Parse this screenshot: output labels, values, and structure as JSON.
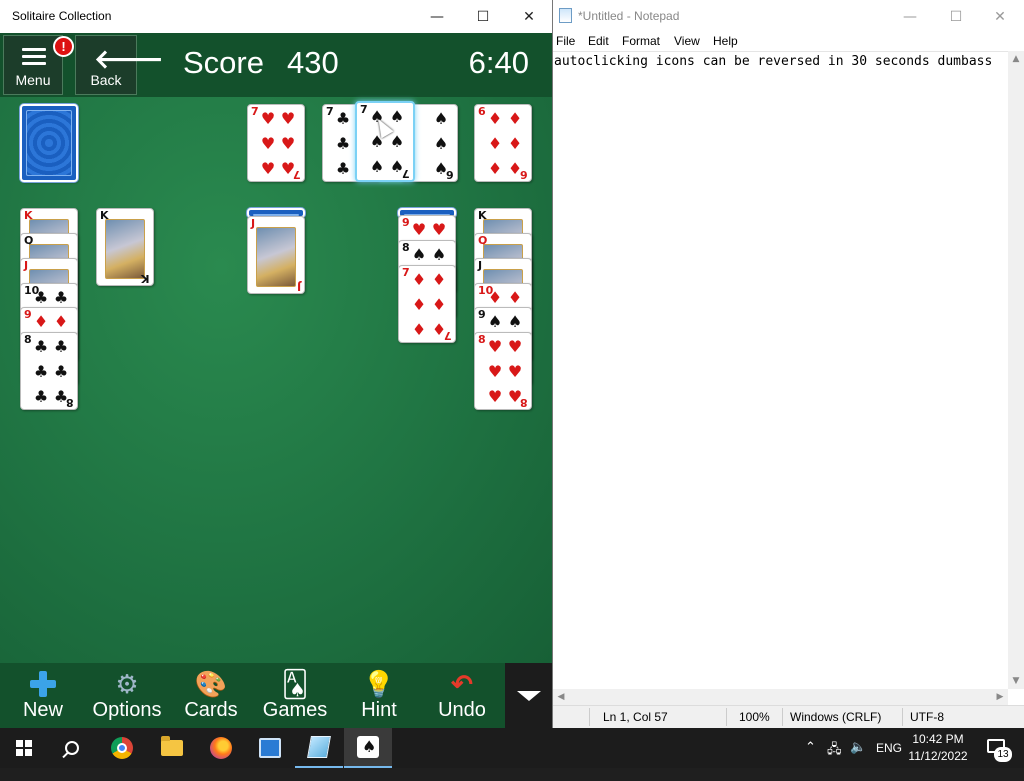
{
  "solitaire": {
    "title": "Solitaire Collection",
    "menu_label": "Menu",
    "alert_badge": "!",
    "back_label": "Back",
    "score_label": "Score",
    "score_value": "430",
    "timer": "6:40",
    "toolbar": {
      "new": "New",
      "options": "Options",
      "cards": "Cards",
      "games": "Games",
      "hint": "Hint",
      "undo": "Undo"
    },
    "cards": {
      "fd_7h": "7",
      "fd_7c": "7",
      "fd_7s": "7",
      "fd_6s": "6",
      "fd_6d": "6",
      "t1_K": "K",
      "t1_Q": "Q",
      "t1_J": "J",
      "t1_10": "10",
      "t1_9": "9",
      "t1_8": "8",
      "t2_K": "K",
      "t3_J": "J",
      "t4_9": "9",
      "t4_8": "8",
      "t4_7": "7",
      "t5_K": "K",
      "t5_Q": "Q",
      "t5_J": "J",
      "t5_10": "10",
      "t5_9": "9",
      "t5_8": "8"
    },
    "suits": {
      "spade": "♠",
      "club": "♣",
      "heart": "♥",
      "diamond": "♦"
    }
  },
  "notepad": {
    "title": "*Untitled - Notepad",
    "menus": [
      "File",
      "Edit",
      "Format",
      "View",
      "Help"
    ],
    "content": "autoclicking icons can be reversed in 30 seconds dumbass",
    "status": {
      "position": "Ln 1, Col 57",
      "zoom": "100%",
      "line_endings": "Windows (CRLF)",
      "encoding": "UTF-8"
    }
  },
  "taskbar": {
    "language": "ENG",
    "time": "10:42 PM",
    "date": "11/12/2022",
    "notification_count": "13"
  },
  "window_controls": {
    "minimize": "—",
    "maximize": "☐",
    "close": "✕"
  },
  "icons": {
    "menu": "hamburger-icon",
    "back": "back-arrow-icon",
    "new": "plus-icon",
    "options": "gear-icon",
    "cards": "palette-icon",
    "games": "cards-icon",
    "hint": "lightbulb-icon",
    "undo": "undo-icon"
  }
}
